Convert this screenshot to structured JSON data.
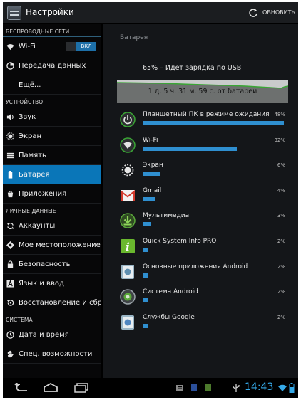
{
  "action_bar": {
    "title": "Настройки",
    "refresh_label": "ОБНОВИТЬ"
  },
  "sidebar": {
    "sections": [
      {
        "title": "БЕСПРОВОДНЫЕ СЕТИ"
      },
      {
        "title": "УСТРОЙСТВО"
      },
      {
        "title": "ЛИЧНЫЕ ДАННЫЕ"
      },
      {
        "title": "СИСТЕМА"
      }
    ],
    "wifi_toggle_label": "ВКЛ",
    "items": [
      {
        "label": "Wi-Fi",
        "icon": "wifi-icon"
      },
      {
        "label": "Передача данных",
        "icon": "data-usage-icon"
      },
      {
        "label": "Ещё...",
        "icon": ""
      },
      {
        "label": "Звук",
        "icon": "speaker-icon"
      },
      {
        "label": "Экран",
        "icon": "brightness-icon"
      },
      {
        "label": "Память",
        "icon": "storage-icon"
      },
      {
        "label": "Батарея",
        "icon": "battery-icon",
        "selected": true
      },
      {
        "label": "Приложения",
        "icon": "apps-icon"
      },
      {
        "label": "Аккаунты",
        "icon": "sync-icon"
      },
      {
        "label": "Мое местоположение",
        "icon": "location-icon"
      },
      {
        "label": "Безопасность",
        "icon": "lock-icon"
      },
      {
        "label": "Язык и ввод",
        "icon": "language-icon"
      },
      {
        "label": "Восстановление и сбро",
        "icon": "restore-icon"
      },
      {
        "label": "Дата и время",
        "icon": "clock-icon"
      },
      {
        "label": "Спец. возможности",
        "icon": "hand-icon"
      }
    ]
  },
  "battery": {
    "title": "Батарея",
    "status": "65% – Идет зарядка по USB",
    "graph_label": "1 д. 5 ч. 31 м. 59 с. от батареи",
    "level_percent": 65,
    "apps": [
      {
        "name": "Планшетный ПК в режиме ожидания",
        "percent": "48%",
        "value": 48,
        "icon": "power-icon"
      },
      {
        "name": "Wi-Fi",
        "percent": "32%",
        "value": 32,
        "icon": "wifi-icon"
      },
      {
        "name": "Экран",
        "percent": "6%",
        "value": 6,
        "icon": "brightness-icon"
      },
      {
        "name": "Gmail",
        "percent": "4%",
        "value": 4,
        "icon": "gmail-icon"
      },
      {
        "name": "Мультимедиа",
        "percent": "3%",
        "value": 3,
        "icon": "download-icon"
      },
      {
        "name": "Quick System Info PRO",
        "percent": "2%",
        "value": 2,
        "icon": "info-app-icon"
      },
      {
        "name": "Основные приложения Android",
        "percent": "2%",
        "value": 2,
        "icon": "android-app-icon"
      },
      {
        "name": "Система Android",
        "percent": "2%",
        "value": 2,
        "icon": "android-system-icon"
      },
      {
        "name": "Службы Google",
        "percent": "2%",
        "value": 2,
        "icon": "google-services-icon"
      }
    ]
  },
  "navbar": {
    "time": "14:43"
  },
  "colors": {
    "accent": "#0a76b8",
    "bar": "#2f8fd0",
    "clock": "#35a9e8",
    "graph_line": "#3aa635"
  }
}
